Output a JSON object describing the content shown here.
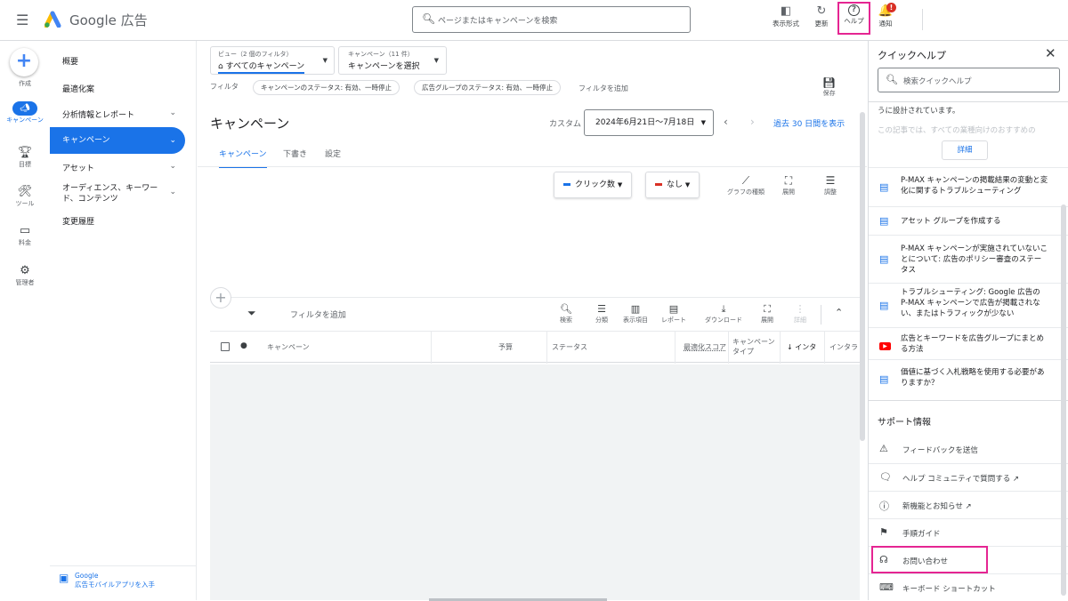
{
  "topbar": {
    "brand": "Google 広告",
    "search_placeholder": "ページまたはキャンペーンを検索",
    "buttons": [
      {
        "icon": "columns-icon",
        "glyph": "◧",
        "label": "表示形式"
      },
      {
        "icon": "refresh-icon",
        "glyph": "↻",
        "label": "更新"
      },
      {
        "icon": "help-icon",
        "glyph": "?",
        "label": "ヘルプ"
      },
      {
        "icon": "bell-icon",
        "glyph": "🔔",
        "label": "通知"
      }
    ],
    "notification_badge": "!"
  },
  "rail": {
    "create": "作成",
    "items": [
      "キャンペーン",
      "目標",
      "ツール",
      "料金",
      "管理者"
    ]
  },
  "nav": {
    "items": [
      "概要",
      "最適化案",
      "分析情報とレポート",
      "キャンペーン",
      "アセット",
      "オーディエンス、キーワード、コンテンツ",
      "変更履歴"
    ],
    "footer_line1": "Google",
    "footer_line2": "広告モバイルアプリを入手"
  },
  "main": {
    "view_sub": "ビュー（2 個のフィルタ）",
    "view_val": "すべてのキャンペーン",
    "camp_sub": "キャンペーン（11 件）",
    "camp_val": "キャンペーンを選択",
    "filter_label": "フィルタ",
    "chips": [
      "キャンペーンのステータス: 有効、一時停止",
      "広告グループのステータス: 有効、一時停止"
    ],
    "add_filter": "フィルタを追加",
    "save": "保存",
    "title": "キャンペーン",
    "custom": "カスタム",
    "date_range": "2024年6月21日～7月18日",
    "last30": "過去 30 日間を表示",
    "tabs": [
      "キャンペーン",
      "下書き",
      "設定"
    ],
    "metric1": "クリック数",
    "metric2": "なし",
    "chart_tools": [
      "グラフの種類",
      "展開",
      "調整"
    ],
    "table_filter": "フィルタを追加",
    "table_tools": [
      "検索",
      "分類",
      "表示項目",
      "レポート",
      "ダウンロード",
      "展開",
      "詳細"
    ],
    "headers": {
      "campaign": "キャンペーン",
      "budget": "予算",
      "status": "ステータス",
      "opt": "最適化スコア",
      "type1": "キャンペーン",
      "type2": "タイプ",
      "inter": "↓ インタ",
      "inter2": "インタラ"
    }
  },
  "panel": {
    "title": "クイックヘルプ",
    "search_placeholder": "検索クイックヘルプ",
    "text1": "うに設計されています。",
    "text2": "この記事では、すべての業種向けのおすすめの",
    "detail": "詳細",
    "articles": [
      "P-MAX キャンペーンの掲載結果の変動と変化に関するトラブルシューティング",
      "アセット グループを作成する",
      "P-MAX キャンペーンが実施されていないことについて: 広告のポリシー審査のステータス",
      "トラブルシューティング: Google 広告の P-MAX キャンペーンで広告が掲載されない、またはトラフィックが少ない",
      "広告とキーワードを広告グループにまとめる方法",
      "価値に基づく入札戦略を使用する必要がありますか？"
    ],
    "support_title": "サポート情報",
    "support": [
      "フィードバックを送信",
      "ヘルプ コミュニティで質問する ↗",
      "新機能とお知らせ ↗",
      "手順ガイド",
      "お問い合わせ",
      "キーボード ショートカット"
    ]
  },
  "colors": {
    "accent": "#1a73e8",
    "highlight": "#e52592",
    "metric1": "#1a73e8",
    "metric2": "#d93025"
  }
}
